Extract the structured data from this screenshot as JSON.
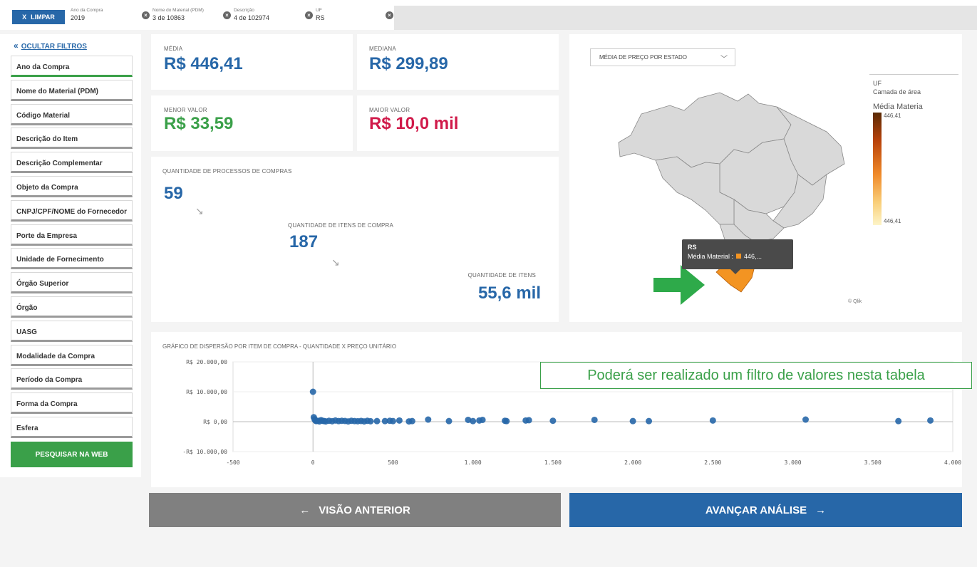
{
  "topbar": {
    "clear_button": "LIMPAR",
    "clear_icon": "X",
    "chips": [
      {
        "label": "Ano da Compra",
        "value": "2019"
      },
      {
        "label": "Nome do Material (PDM)",
        "value": "3 de 10863"
      },
      {
        "label": "Descrição",
        "value": "4 de 102974"
      },
      {
        "label": "UF",
        "value": "RS"
      }
    ]
  },
  "sidebar": {
    "hide_filters": "OCULTAR FILTROS",
    "items": [
      "Ano da Compra",
      "Nome do Material (PDM)",
      "Código Material",
      "Descrição do Item",
      "Descrição Complementar",
      "Objeto da Compra",
      "CNPJ/CPF/NOME do Fornecedor",
      "Porte da Empresa",
      "Unidade de Fornecimento",
      "Órgão Superior",
      "Órgão",
      "UASG",
      "Modalidade da Compra",
      "Período da Compra",
      "Forma da Compra",
      "Esfera"
    ],
    "search_web": "PESQUISAR NA WEB"
  },
  "kpis": {
    "media": {
      "label": "MÉDIA",
      "value": "R$ 446,41"
    },
    "mediana": {
      "label": "MEDIANA",
      "value": "R$ 299,89"
    },
    "menor": {
      "label": "MENOR VALOR",
      "value": "R$ 33,59"
    },
    "maior": {
      "label": "MAIOR VALOR",
      "value": "R$ 10,0 mil"
    },
    "processos": {
      "label": "QUANTIDADE DE PROCESSOS DE COMPRAS",
      "value": "59"
    },
    "itens_compra": {
      "label": "QUANTIDADE DE ITENS DE COMPRA",
      "value": "187"
    },
    "itens": {
      "label": "QUANTIDADE DE ITENS",
      "value": "55,6 mil"
    }
  },
  "map": {
    "dropdown": "MÉDIA DE PREÇO POR ESTADO",
    "legend": {
      "line1": "UF",
      "line2": "Camada de área",
      "line3": "Média Materia",
      "max": "446,41",
      "min": "446,41"
    },
    "tooltip": {
      "title": "RS",
      "label": "Média Material :",
      "value": "446,..."
    },
    "credit": "© Qlik",
    "colors": {
      "highlight": "#f39422",
      "base": "#d9d9d9"
    }
  },
  "scatter": {
    "title": "GRÁFICO DE DISPERSÃO POR ITEM DE COMPRA - QUANTIDADE X PREÇO UNITÁRIO",
    "annotation": "Poderá ser realizado um filtro de valores nesta tabela"
  },
  "chart_data": {
    "type": "scatter",
    "title": "GRÁFICO DE DISPERSÃO POR ITEM DE COMPRA - QUANTIDADE X PREÇO UNITÁRIO",
    "xlabel": "",
    "ylabel": "",
    "xlim": [
      -500,
      4000
    ],
    "ylim": [
      -10000,
      20000
    ],
    "x_ticks": [
      "-500",
      "0",
      "500",
      "1.000",
      "1.500",
      "2.000",
      "2.500",
      "3.000",
      "3.500",
      "4.000"
    ],
    "y_ticks": [
      "R$ 20.000,00",
      "R$ 10.000,00",
      "R$ 0,00",
      "-R$ 10.000,00"
    ],
    "color": "#2767a8",
    "points": [
      [
        0,
        10000
      ],
      [
        5,
        1500
      ],
      [
        10,
        800
      ],
      [
        15,
        400
      ],
      [
        20,
        200
      ],
      [
        30,
        300
      ],
      [
        40,
        100
      ],
      [
        50,
        500
      ],
      [
        60,
        300
      ],
      [
        70,
        200
      ],
      [
        80,
        100
      ],
      [
        100,
        300
      ],
      [
        120,
        150
      ],
      [
        140,
        400
      ],
      [
        160,
        200
      ],
      [
        180,
        300
      ],
      [
        200,
        250
      ],
      [
        220,
        100
      ],
      [
        240,
        300
      ],
      [
        260,
        200
      ],
      [
        280,
        150
      ],
      [
        300,
        250
      ],
      [
        320,
        100
      ],
      [
        340,
        300
      ],
      [
        360,
        150
      ],
      [
        400,
        200
      ],
      [
        450,
        200
      ],
      [
        480,
        300
      ],
      [
        500,
        200
      ],
      [
        540,
        400
      ],
      [
        600,
        100
      ],
      [
        620,
        200
      ],
      [
        720,
        700
      ],
      [
        850,
        200
      ],
      [
        970,
        600
      ],
      [
        1000,
        200
      ],
      [
        1040,
        400
      ],
      [
        1060,
        600
      ],
      [
        1200,
        300
      ],
      [
        1210,
        200
      ],
      [
        1330,
        400
      ],
      [
        1350,
        500
      ],
      [
        1500,
        300
      ],
      [
        1760,
        600
      ],
      [
        2000,
        200
      ],
      [
        2100,
        200
      ],
      [
        2500,
        400
      ],
      [
        3080,
        700
      ],
      [
        3660,
        200
      ],
      [
        3860,
        400
      ]
    ]
  },
  "nav": {
    "prev": "VISÃO ANTERIOR",
    "next": "AVANÇAR ANÁLISE",
    "prev_icon": "←",
    "next_icon": "→"
  }
}
